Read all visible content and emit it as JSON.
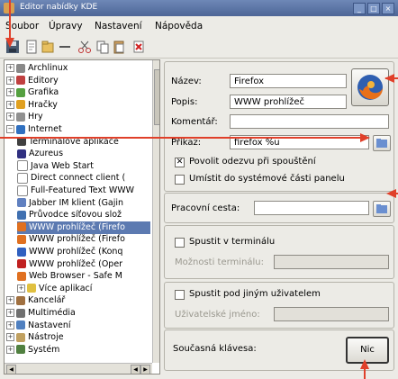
{
  "window": {
    "title": "Editor nabídky KDE"
  },
  "menubar": [
    {
      "label": "Soubor"
    },
    {
      "label": "Úpravy"
    },
    {
      "label": "Nastavení"
    },
    {
      "label": "Nápověda"
    }
  ],
  "tree": {
    "items": [
      {
        "label": "Archlinux",
        "level": 0,
        "color": "#888888"
      },
      {
        "label": "Editory",
        "level": 0,
        "color": "#c04040"
      },
      {
        "label": "Grafika",
        "level": 0,
        "color": "#55a040"
      },
      {
        "label": "Hračky",
        "level": 0,
        "color": "#e0a020"
      },
      {
        "label": "Hry",
        "level": 0,
        "color": "#909090"
      },
      {
        "label": "Internet",
        "level": 0,
        "color": "#3070c0",
        "expanded": true
      },
      {
        "label": "Terminálové aplikace",
        "level": 1,
        "color": "#404040"
      },
      {
        "label": "Azureus",
        "level": 1,
        "color": "#303080"
      },
      {
        "label": "Java Web Start",
        "level": 1,
        "color": "#ffffff"
      },
      {
        "label": "Direct connect client (",
        "level": 1,
        "color": "#ffffff"
      },
      {
        "label": "Full-Featured Text WWW",
        "level": 1,
        "color": "#ffffff"
      },
      {
        "label": "Jabber IM klient (Gajin",
        "level": 1,
        "color": "#6080c0"
      },
      {
        "label": "Průvodce síťovou slož",
        "level": 1,
        "color": "#4070b0"
      },
      {
        "label": "WWW prohlížeč (Firefo",
        "level": 1,
        "color": "#e07020",
        "selected": true
      },
      {
        "label": "WWW prohlížeč (Firefo",
        "level": 1,
        "color": "#e07020"
      },
      {
        "label": "WWW prohlížeč (Konq",
        "level": 1,
        "color": "#3060c0"
      },
      {
        "label": "WWW prohlížeč (Oper",
        "level": 1,
        "color": "#c02020"
      },
      {
        "label": "Web Browser - Safe M",
        "level": 1,
        "color": "#e07020"
      },
      {
        "label": "Více aplikací",
        "level": 1,
        "color": "#e0c040"
      },
      {
        "label": "Kancelář",
        "level": 0,
        "color": "#a07040"
      },
      {
        "label": "Multimédia",
        "level": 0,
        "color": "#707070"
      },
      {
        "label": "Nastavení",
        "level": 0,
        "color": "#5080c0"
      },
      {
        "label": "Nástroje",
        "level": 0,
        "color": "#c0a060"
      },
      {
        "label": "Systém",
        "level": 0,
        "color": "#508040"
      }
    ]
  },
  "form": {
    "name_label": "Název:",
    "name_value": "Firefox",
    "desc_label": "Popis:",
    "desc_value": "WWW prohlížeč",
    "comment_label": "Komentář:",
    "comment_value": "",
    "command_label": "Příkaz:",
    "command_value": "firefox %u",
    "feedback_label": "Povolit odezvu při spouštění",
    "feedback_checked": true,
    "systray_label": "Umístit do systémové části panelu",
    "systray_checked": false,
    "workdir_label": "Pracovní cesta:",
    "workdir_value": "",
    "terminal_label": "Spustit v terminálu",
    "terminal_options_label": "Možnosti terminálu:",
    "otheruser_label": "Spustit pod jiným uživatelem",
    "username_label": "Uživatelské jméno:",
    "shortcut_label": "Současná klávesa:",
    "shortcut_button": "Nic"
  },
  "colors": {
    "annotation": "#e0402a",
    "selection": "#5c7ab1",
    "titlebar": "#5a72a4"
  }
}
